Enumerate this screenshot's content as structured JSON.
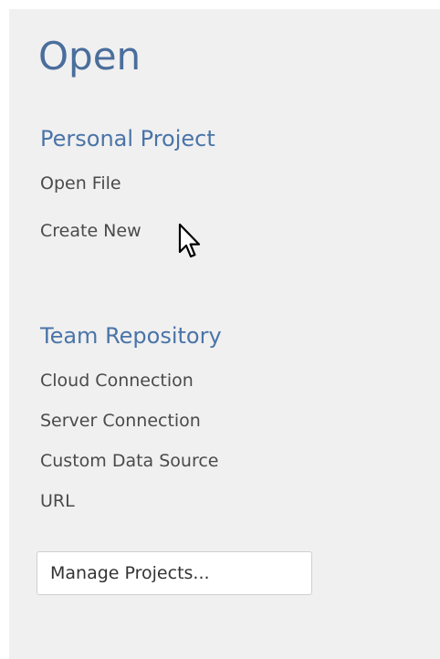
{
  "panel": {
    "title": "Open",
    "personal_project": {
      "heading": "Personal Project",
      "items": [
        {
          "label": "Open File"
        },
        {
          "label": "Create New"
        }
      ]
    },
    "team_repository": {
      "heading": "Team Repository",
      "items": [
        {
          "label": "Cloud Connection"
        },
        {
          "label": "Server Connection"
        },
        {
          "label": "Custom Data Source"
        },
        {
          "label": "URL"
        }
      ]
    },
    "manage_projects_label": "Manage Projects..."
  },
  "cursor": {
    "icon": "arrow-pointer-icon"
  },
  "colors": {
    "panel_background": "#f0f0f0",
    "heading_blue": "#4a74a8",
    "title_blue": "#4a6e9c",
    "link_text": "#4a4a4a"
  }
}
